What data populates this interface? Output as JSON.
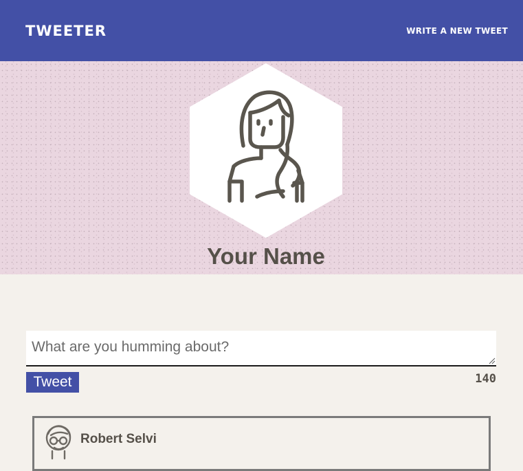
{
  "nav": {
    "brand": "Tweeter",
    "compose_link": "Write a new tweet"
  },
  "profile": {
    "name": "Your Name",
    "avatar_icon": "female-user-avatar-icon"
  },
  "composer": {
    "placeholder": "What are you humming about?",
    "value": "",
    "submit_label": "Tweet",
    "char_counter": "140"
  },
  "tweets": [
    {
      "author": "Robert Selvi",
      "avatar_icon": "male-user-avatar-icon"
    }
  ],
  "colors": {
    "nav_background": "#4350a6",
    "hero_background": "#ead6e0",
    "page_background": "#f4f1ec",
    "text_dark": "#555049",
    "button": "#4350a6"
  }
}
